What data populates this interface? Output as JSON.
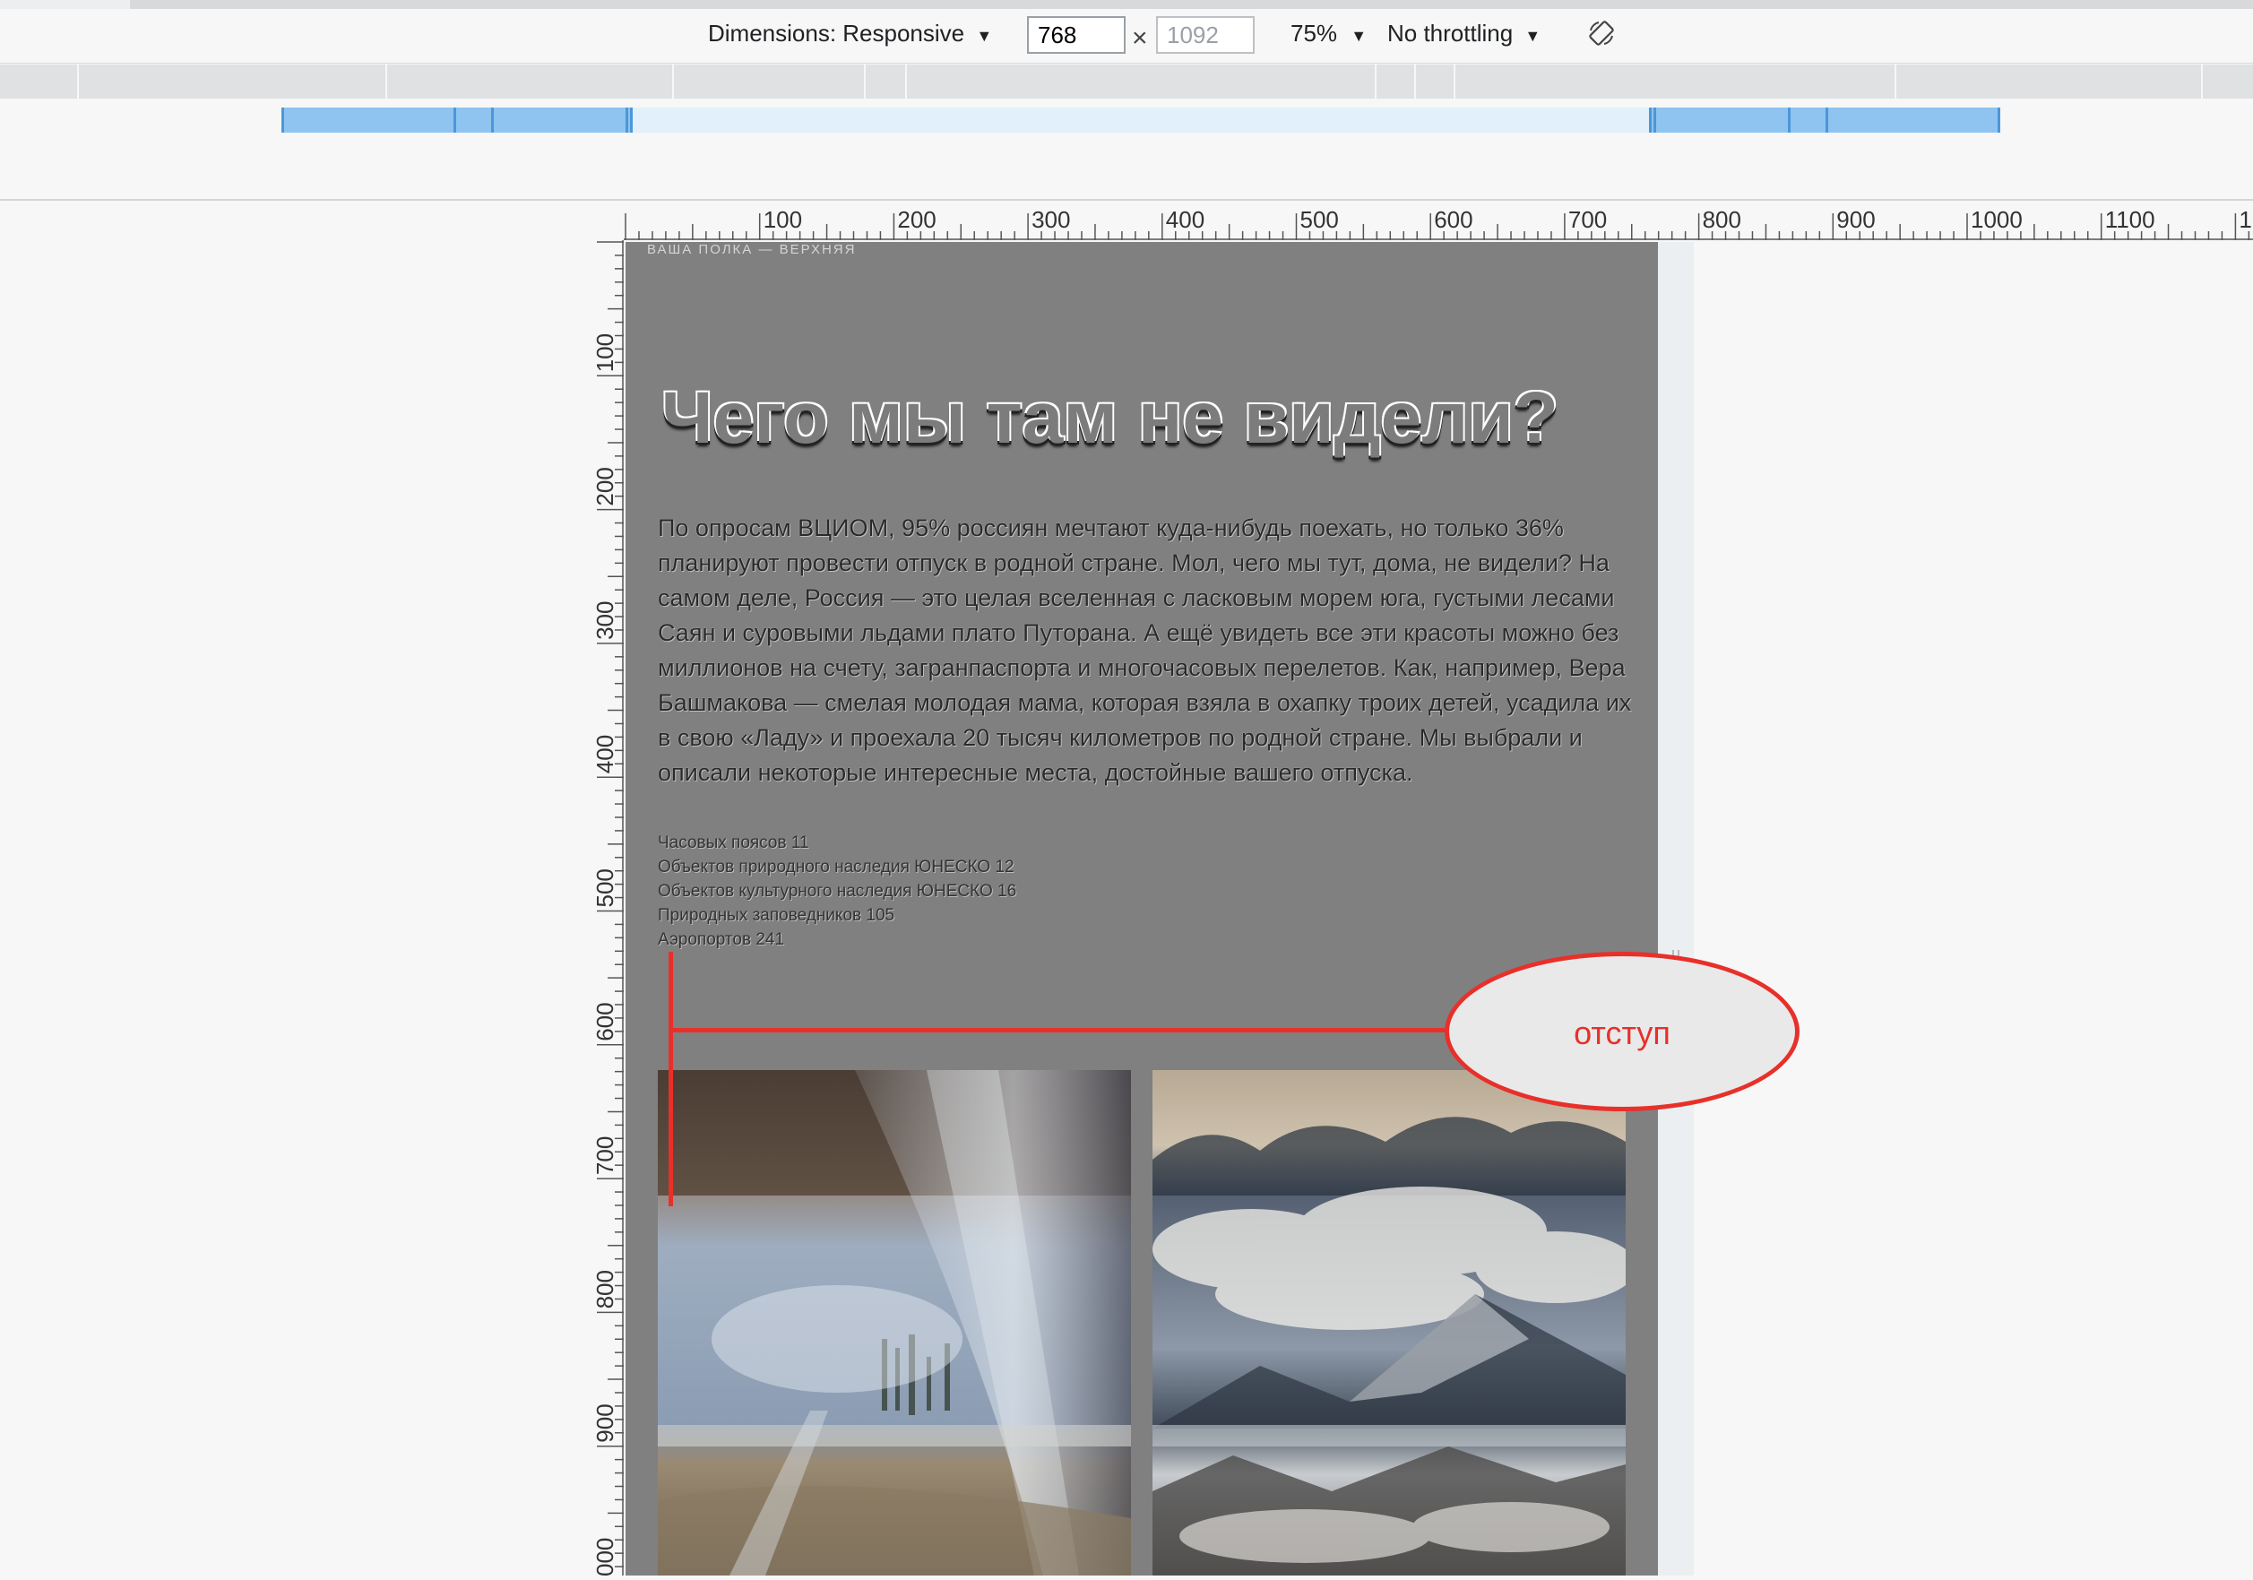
{
  "toolbar": {
    "dimensions_label": "Dimensions: Responsive",
    "width_value": "768",
    "times": "×",
    "height_placeholder": "1092",
    "zoom": "75%",
    "throttling": "No throttling",
    "rotate_icon": "rotate-icon"
  },
  "rulers": {
    "top": [
      "100",
      "200",
      "300",
      "400",
      "500",
      "600",
      "700",
      "800",
      "900",
      "1000",
      "1100",
      "1"
    ],
    "left": [
      "100",
      "200",
      "300",
      "400",
      "500",
      "600",
      "700",
      "800",
      "900",
      "000"
    ]
  },
  "page": {
    "kicker": "ВАША ПОЛКА — ВЕРХНЯЯ",
    "title": "Чего мы там не видели?",
    "intro": "По опросам ВЦИОМ, 95% россиян мечтают куда-нибудь поехать, но только 36% планируют провести отпуск в родной стране. Мол, чего мы тут, дома, не видели? На самом деле, Россия — это целая вселенная с ласковым морем юга, густыми лесами Саян и суровыми льдами плато Путорана. А ещё увидеть все эти красоты можно без миллионов на счету, загранпаспорта и многочасовых перелетов. Как, например, Вера Башмакова — смелая молодая мама, которая взяла в охапку троих детей, усадила их в свою «Ладу» и проехала 20 тысяч километров по родной стране. Мы выбрали и описали некоторые интересные места, достойные вашего отпуска.",
    "stats": [
      "Часовых поясов 11",
      "Объектов природного наследия ЮНЕСКО 12",
      "Объектов культурного наследия ЮНЕСКО 16",
      "Природных заповедников 105",
      "Аэропортов 241"
    ]
  },
  "annotation": {
    "label": "отступ",
    "color": "#e8302a"
  }
}
